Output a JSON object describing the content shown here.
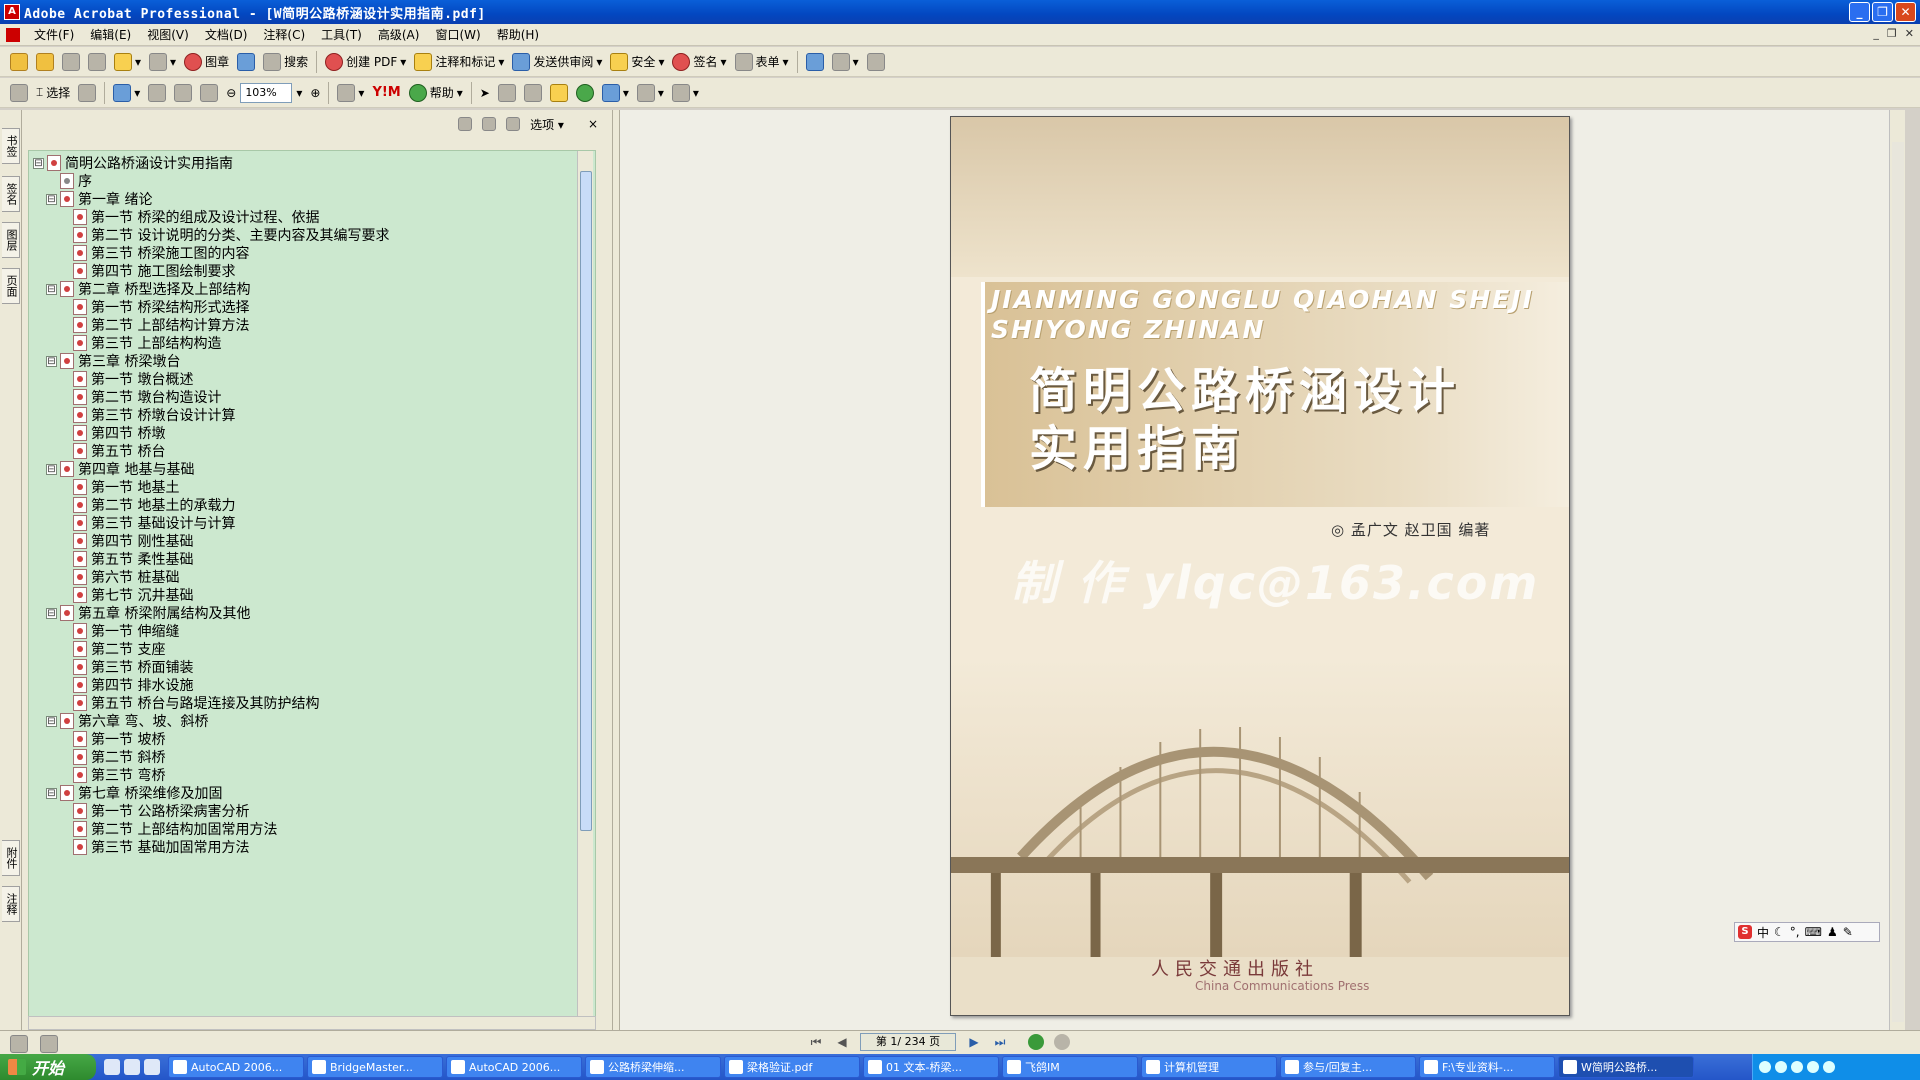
{
  "window": {
    "title": "Adobe Acrobat Professional - [W简明公路桥涵设计实用指南.pdf]"
  },
  "menu": [
    "文件(F)",
    "编辑(E)",
    "视图(V)",
    "文档(D)",
    "注释(C)",
    "工具(T)",
    "高级(A)",
    "窗口(W)",
    "帮助(H)"
  ],
  "toolbar1": {
    "items": [
      "图章",
      "搜索",
      "创建 PDF",
      "注释和标记",
      "发送供审阅",
      "安全",
      "签名",
      "表单"
    ]
  },
  "toolbar2": {
    "select_label": "选择",
    "zoom_value": "103%",
    "help_label": "帮助"
  },
  "left_tabs": [
    "书签",
    "签名",
    "图层",
    "页面",
    "附件",
    "注释"
  ],
  "bookmarks_panel": {
    "options_label": "选项",
    "close_label": "×"
  },
  "bookmarks": [
    {
      "level": 0,
      "toggle": "⊟",
      "label": "简明公路桥涵设计实用指南"
    },
    {
      "level": 1,
      "toggle": "",
      "label": "序"
    },
    {
      "level": 1,
      "toggle": "⊟",
      "label": "第一章  绪论"
    },
    {
      "level": 2,
      "toggle": "",
      "label": "第一节 桥梁的组成及设计过程、依据"
    },
    {
      "level": 2,
      "toggle": "",
      "label": "第二节 设计说明的分类、主要内容及其编写要求"
    },
    {
      "level": 2,
      "toggle": "",
      "label": "第三节 桥梁施工图的内容"
    },
    {
      "level": 2,
      "toggle": "",
      "label": "第四节 施工图绘制要求"
    },
    {
      "level": 1,
      "toggle": "⊟",
      "label": "第二章 桥型选择及上部结构"
    },
    {
      "level": 2,
      "toggle": "",
      "label": "第一节 桥梁结构形式选择"
    },
    {
      "level": 2,
      "toggle": "",
      "label": "第二节 上部结构计算方法"
    },
    {
      "level": 2,
      "toggle": "",
      "label": "第三节 上部结构构造"
    },
    {
      "level": 1,
      "toggle": "⊟",
      "label": "第三章 桥梁墩台"
    },
    {
      "level": 2,
      "toggle": "",
      "label": "第一节 墩台概述"
    },
    {
      "level": 2,
      "toggle": "",
      "label": "第二节 墩台构造设计"
    },
    {
      "level": 2,
      "toggle": "",
      "label": "第三节 桥墩台设计计算"
    },
    {
      "level": 2,
      "toggle": "",
      "label": "第四节 桥墩"
    },
    {
      "level": 2,
      "toggle": "",
      "label": "第五节 桥台"
    },
    {
      "level": 1,
      "toggle": "⊟",
      "label": "第四章 地基与基础"
    },
    {
      "level": 2,
      "toggle": "",
      "label": "第一节 地基土"
    },
    {
      "level": 2,
      "toggle": "",
      "label": "第二节 地基土的承载力"
    },
    {
      "level": 2,
      "toggle": "",
      "label": "第三节 基础设计与计算"
    },
    {
      "level": 2,
      "toggle": "",
      "label": "第四节 刚性基础"
    },
    {
      "level": 2,
      "toggle": "",
      "label": "第五节 柔性基础"
    },
    {
      "level": 2,
      "toggle": "",
      "label": "第六节 桩基础"
    },
    {
      "level": 2,
      "toggle": "",
      "label": "第七节 沉井基础"
    },
    {
      "level": 1,
      "toggle": "⊟",
      "label": "第五章 桥梁附属结构及其他"
    },
    {
      "level": 2,
      "toggle": "",
      "label": "第一节 伸缩缝"
    },
    {
      "level": 2,
      "toggle": "",
      "label": "第二节 支座"
    },
    {
      "level": 2,
      "toggle": "",
      "label": "第三节 桥面铺装"
    },
    {
      "level": 2,
      "toggle": "",
      "label": "第四节 排水设施"
    },
    {
      "level": 2,
      "toggle": "",
      "label": "第五节 桥台与路堤连接及其防护结构"
    },
    {
      "level": 1,
      "toggle": "⊟",
      "label": "第六章 弯、坡、斜桥"
    },
    {
      "level": 2,
      "toggle": "",
      "label": "第一节 坡桥"
    },
    {
      "level": 2,
      "toggle": "",
      "label": "第二节 斜桥"
    },
    {
      "level": 2,
      "toggle": "",
      "label": "第三节 弯桥"
    },
    {
      "level": 1,
      "toggle": "⊟",
      "label": "第七章 桥梁维修及加固"
    },
    {
      "level": 2,
      "toggle": "",
      "label": "第一节 公路桥梁病害分析"
    },
    {
      "level": 2,
      "toggle": "",
      "label": "第二节 上部结构加固常用方法"
    },
    {
      "level": 2,
      "toggle": "",
      "label": "第三节 基础加固常用方法"
    }
  ],
  "cover": {
    "pinyin_line1": "JIANMING GONGLU QIAOHAN SHEJI",
    "pinyin_line2": "SHIYONG ZHINAN",
    "title_line1": "简明公路桥涵设计",
    "title_line2": "实用指南",
    "authors": "◎ 孟广文   赵卫国   编著",
    "watermark": "制 作 ylqc@163.com",
    "publisher_cn": "人民交通出版社",
    "publisher_en": "China Communications Press"
  },
  "status": {
    "page_indicator": "第 1/ 234 页"
  },
  "ime": {
    "label": "中"
  },
  "taskbar": {
    "start_label": "开始",
    "tasks": [
      "AutoCAD 2006...",
      "BridgeMaster...",
      "AutoCAD 2006...",
      "公路桥梁伸缩...",
      "梁格验证.pdf",
      "01 文本-桥梁...",
      "飞鸽IM",
      "计算机管理",
      "参与/回复主...",
      "F:\\专业资料-...",
      "W简明公路桥..."
    ]
  }
}
